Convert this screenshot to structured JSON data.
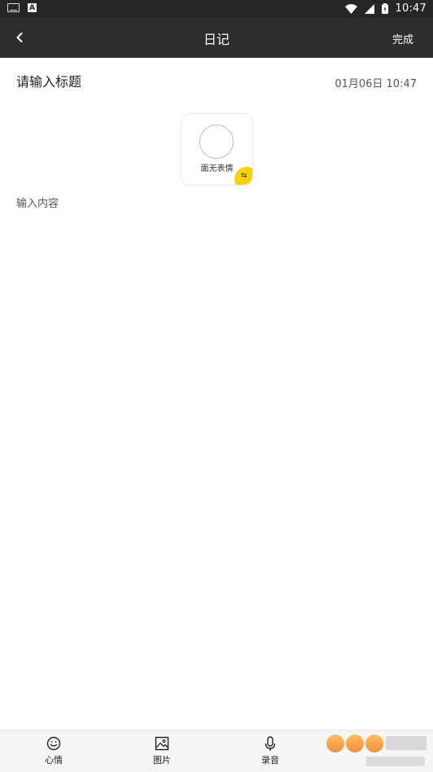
{
  "status_bar": {
    "time": "10:47"
  },
  "app_bar": {
    "title": "日记",
    "done_label": "完成"
  },
  "entry": {
    "title_placeholder": "请输入标题",
    "datetime": "01月06日 10:47",
    "content_placeholder": "输入内容"
  },
  "mood": {
    "label": "面无表情"
  },
  "toolbar": {
    "items": [
      {
        "label": "心情",
        "icon": "smiley-icon"
      },
      {
        "label": "图片",
        "icon": "image-icon"
      },
      {
        "label": "录音",
        "icon": "microphone-icon"
      }
    ]
  },
  "colors": {
    "appbar": "#2d2d2d",
    "accent": "#f6d20a"
  }
}
